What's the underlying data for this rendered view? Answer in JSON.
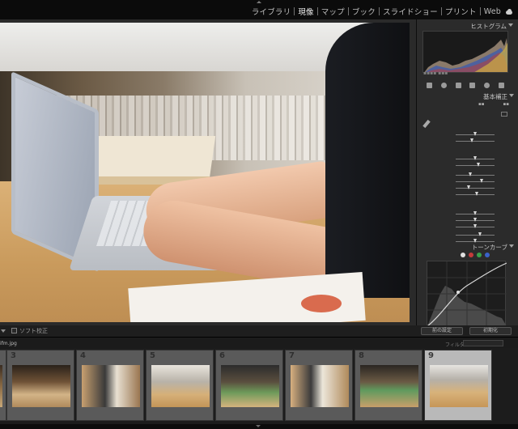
{
  "modules": {
    "items": [
      {
        "label": "ライブラリ",
        "active": false
      },
      {
        "label": "現像",
        "active": true
      },
      {
        "label": "マップ",
        "active": false
      },
      {
        "label": "ブック",
        "active": false
      },
      {
        "label": "スライドショー",
        "active": false
      },
      {
        "label": "プリント",
        "active": false
      },
      {
        "label": "Web",
        "active": false
      }
    ]
  },
  "viewer_bar": {
    "softproof_label": "ソフト校正"
  },
  "right_panel": {
    "histogram_title": "ヒストグラム",
    "basic_title": "基本補正",
    "tone_curve_title": "トーンカーブ",
    "buttons": {
      "previous": "前の設定",
      "reset": "初期化"
    }
  },
  "filmstrip": {
    "source_label": "ifm.jpg",
    "filter_label": "フィルター",
    "cells": [
      {
        "number": "3",
        "selected": false,
        "scene": "office"
      },
      {
        "number": "4",
        "selected": false,
        "scene": "office-people"
      },
      {
        "number": "5",
        "selected": false,
        "scene": "laptop-hands"
      },
      {
        "number": "6",
        "selected": false,
        "scene": "laptop-desk"
      },
      {
        "number": "7",
        "selected": false,
        "scene": "office-people"
      },
      {
        "number": "8",
        "selected": false,
        "scene": "office-green"
      },
      {
        "number": "9",
        "selected": true,
        "scene": "laptop-hands"
      }
    ]
  },
  "colors": {
    "background": "#141414",
    "panel": "#2b2b2b",
    "selected_cell": "#b9b9b9"
  }
}
